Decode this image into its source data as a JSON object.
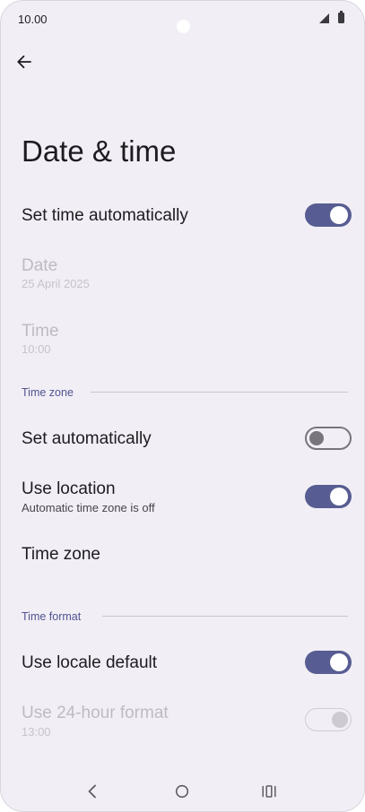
{
  "status_bar": {
    "time": "10.00",
    "signal_icon": "cellular-signal-icon",
    "battery_icon": "battery-icon"
  },
  "header": {
    "back_icon": "arrow-back-icon",
    "title": "Date & time"
  },
  "settings": {
    "set_time_automatically": {
      "label": "Set time automatically",
      "enabled": true
    },
    "date": {
      "label": "Date",
      "value": "25 April 2025",
      "disabled": true
    },
    "time": {
      "label": "Time",
      "value": "10:00",
      "disabled": true
    },
    "time_zone_section": {
      "header": "Time zone"
    },
    "set_automatically": {
      "label": "Set automatically",
      "enabled": false
    },
    "use_location": {
      "label": "Use location",
      "summary": "Automatic time zone is off",
      "enabled": true
    },
    "time_zone": {
      "label": "Time zone"
    },
    "time_format_section": {
      "header": "Time format"
    },
    "use_locale_default": {
      "label": "Use locale default",
      "enabled": true
    },
    "use_24_hour_format": {
      "label": "Use 24-hour format",
      "example": "13:00",
      "enabled": true,
      "disabled": true
    }
  },
  "nav_bar": {
    "back_icon": "nav-back-icon",
    "home_icon": "nav-home-icon",
    "recents_icon": "nav-recents-icon"
  },
  "colors": {
    "background": "#f1eef5",
    "accent": "#575d92",
    "section_header": "#4f5390",
    "text_primary": "#1d1b20",
    "text_disabled": "#bfbbc4"
  }
}
